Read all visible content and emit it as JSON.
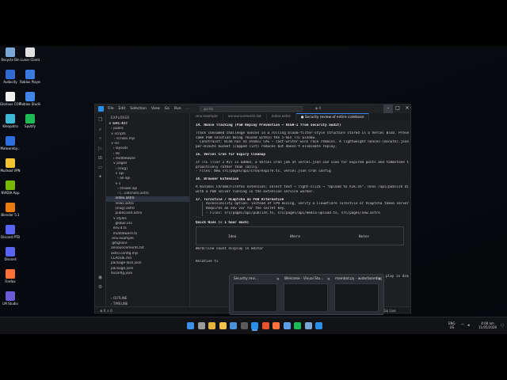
{
  "desktop_icons": [
    {
      "label": "Recycle Bin",
      "icon": "recycle-bin-icon",
      "color": "#7aa7d6"
    },
    {
      "label": "Lunar Client",
      "icon": "lunar-client-icon",
      "color": "#e0e0e0"
    },
    {
      "label": "Audacity",
      "icon": "audacity-icon",
      "color": "#2f6bd1"
    },
    {
      "label": "Roblox Player",
      "icon": "roblox-player-icon",
      "color": "#3a7be0"
    },
    {
      "label": "Glorious CORE",
      "icon": "glorious-core-icon",
      "color": "#f0f0f0"
    },
    {
      "label": "Roblox Studio",
      "icon": "roblox-studio-icon",
      "color": "#3f86e8"
    },
    {
      "label": "Kleopatra",
      "icon": "kleopatra-icon",
      "color": "#3cb8d8"
    },
    {
      "label": "Spotify",
      "icon": "spotify-icon",
      "color": "#1db954"
    },
    {
      "label": "Malwareby...",
      "icon": "malwarebytes-icon",
      "color": "#2d6ee0"
    },
    {
      "label": "Mullvad VPN",
      "icon": "mullvad-vpn-icon",
      "color": "#f4c430"
    },
    {
      "label": "NVIDIA App",
      "icon": "nvidia-app-icon",
      "color": "#76b900"
    },
    {
      "label": "Blender 5.1",
      "icon": "blender-icon",
      "color": "#e87d0d"
    },
    {
      "label": "Discord PTB",
      "icon": "discord-ptb-icon",
      "color": "#5865f2"
    },
    {
      "label": "Discord",
      "icon": "discord-icon",
      "color": "#5865f2"
    },
    {
      "label": "Firefox",
      "icon": "firefox-icon",
      "color": "#ff7139"
    },
    {
      "label": "LM Studio",
      "icon": "lm-studio-icon",
      "color": "#6b5bd6"
    }
  ],
  "vscode": {
    "menu": [
      "File",
      "Edit",
      "Selection",
      "View",
      "Go",
      "Run",
      "..."
    ],
    "search": "ipc-tls",
    "commands": "◈ 4",
    "explorer": {
      "title": "EXPLORER",
      "root": "∨ SRC-KIT",
      "tree": [
        "› public",
        "∨ scripts",
        "   › scrubs.mjs",
        "∨ src",
        "  › layouts",
        "  › lib",
        "  › middleware",
        "  ∨ pages",
        "    › [slug]",
        "    ∨ api",
        "      › all-api",
        "    ∨ s",
        "      › shaaer.api",
        "      › [...catchall].astro",
        "    index.astro",
        "    news.astro",
        "    [slug].astro",
        "    publicised.astro",
        "  ∨ styles",
        "    global.css",
        "  env.d.ts",
        "  middleware.ts",
        ".env.example",
        ".gitignore",
        "announcements.txt",
        "astro.config.mjs",
        "CLAUDE.md",
        "package-lock.json",
        "package.json",
        "tsconfig.json"
      ],
      "selected_index": 14,
      "footer": [
        "› OUTLINE",
        "› TIMELINE"
      ]
    },
    "tabs": [
      {
        "label": ".env.example",
        "active": false
      },
      {
        "label": "announcements.txt",
        "active": false
      },
      {
        "label": "index.astro",
        "active": false
      },
      {
        "label": "● Security review of entire codebase",
        "active": true
      }
    ],
    "editor_lines": [
      {
        "text": "14. Nonce Tracking (PoW Replay Prevention — HIGH-1 from security audit)",
        "cls": "h"
      },
      {
        "text": "",
        "cls": "blank"
      },
      {
        "text": "Track consumed challenge nonces in a rolling bloom-filter-style structure stored in a Vercel Blob. Prevents the",
        "cls": ""
      },
      {
        "text": "same PoW solution being reused within the 5-min TTL window.",
        "cls": ""
      },
      {
        "text": "- Constraint: Blob has no atomic CAS — last-writer-wins race remains. A lightweight nonces-[minute].json",
        "cls": ""
      },
      {
        "text": "per-minute bucket (capped list) reduces but doesn't eliminate replay.",
        "cls": ""
      },
      {
        "text": "",
        "cls": "blank"
      },
      {
        "text": "15. Vercel Cron for Expiry Cleanup",
        "cls": "h"
      },
      {
        "text": "",
        "cls": "blank"
      },
      {
        "text": "If TTL (Tier 2 #2) is added, a Vercel cron job at vercel.json can scan for expired posts and tombstone them",
        "cls": ""
      },
      {
        "text": "proactively rather than lazily.",
        "cls": ""
      },
      {
        "text": "- Files: New src/pages/api/cron/expire.ts, vercel.json cron config",
        "cls": ""
      },
      {
        "text": "",
        "cls": "blank"
      },
      {
        "text": "16. Browser Extension",
        "cls": "h"
      },
      {
        "text": "",
        "cls": "blank"
      },
      {
        "text": "A minimal Chrome/Firefox extension: select text → right-click → \"Upload to h1k.sh\". Uses /api/publish directly",
        "cls": ""
      },
      {
        "text": "with a PoW solver running in the extension service worker.",
        "cls": ""
      },
      {
        "text": "",
        "cls": "blank"
      },
      {
        "text": "17. Turnstile / hCaptcha as PoW Alternative",
        "cls": "h"
      }
    ],
    "quote_lines": [
      "Accessibility option: instead of CPU mining, verify a Cloudflare Turnstile or hCaptcha token server-side.",
      "Requires an env var for the secret key.",
      "- Files: src/pages/api/publish.ts, src/pages/api/media-upload.ts, src/pages/new.astro"
    ],
    "sep": "---",
    "quick_wins": "Quick Wins (< 1 hour each)",
    "table_headers": [
      "Idea",
      "Where",
      "Notes"
    ],
    "table_row_text": "Word/line count display in editor",
    "table_row_right": "play in dim",
    "relative_text": "Relative ti",
    "status_left": "⊗ 0 ⚠ 0",
    "status_right": "✓ Go Live"
  },
  "previews": [
    {
      "title": "Security revi...",
      "icon": "vscode-icon"
    },
    {
      "title": "Welcome - Visual Stu...",
      "icon": "vscode-icon"
    },
    {
      "title": "mainbot.py - waterboarding...",
      "icon": "vscode-icon"
    }
  ],
  "taskbar": {
    "apps": [
      {
        "icon": "start-icon",
        "color": "#3b8eea"
      },
      {
        "icon": "search-icon",
        "color": "#9a9a9a"
      },
      {
        "icon": "chrome-icon",
        "color": "#e6b23c"
      },
      {
        "icon": "file-explorer-icon",
        "color": "#f2c14e"
      },
      {
        "icon": "store-icon",
        "color": "#4a90d9"
      },
      {
        "icon": "terminal-icon",
        "color": "#5a5a5a"
      },
      {
        "icon": "vscode-icon",
        "color": "#2a8fe8"
      },
      {
        "icon": "brave-icon",
        "color": "#e8542c"
      },
      {
        "icon": "firefox-icon",
        "color": "#ff7139"
      },
      {
        "icon": "vpn-icon",
        "color": "#5aa0e8"
      },
      {
        "icon": "spotify-icon",
        "color": "#1db954"
      },
      {
        "icon": "app-icon",
        "color": "#7aa7d6"
      },
      {
        "icon": "vscode-icon",
        "color": "#2a8fe8"
      }
    ],
    "tray": {
      "language": "ENG",
      "region": "US",
      "time": "4:08 am",
      "date": "11/05/2026"
    }
  }
}
